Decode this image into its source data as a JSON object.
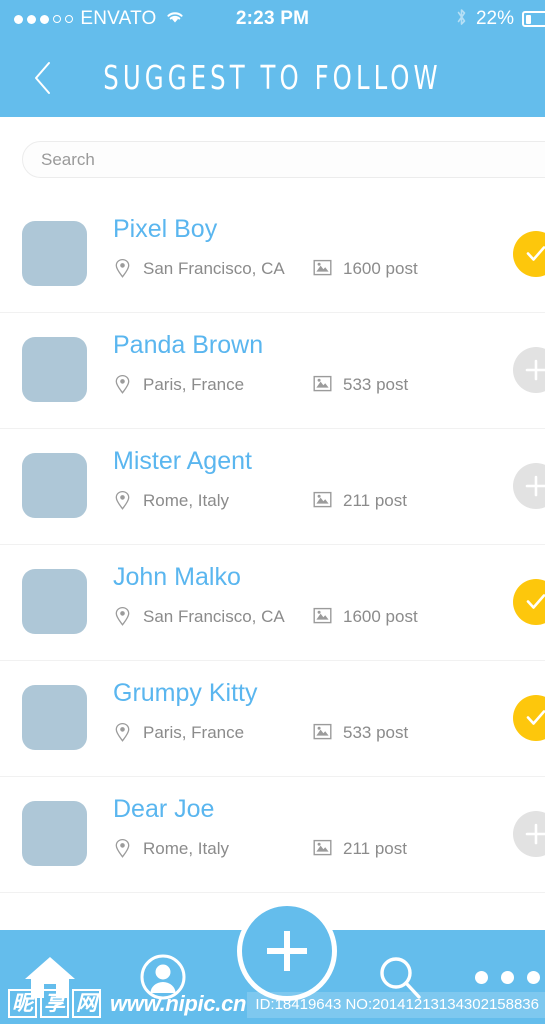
{
  "statusbar": {
    "signal_filled": 3,
    "signal_empty": 2,
    "carrier": "ENVATO",
    "wifi_icon": "wifi-icon",
    "time": "2:23 PM",
    "bluetooth_icon": "bluetooth-icon",
    "battery_percent": "22%",
    "battery_level": 22
  },
  "navbar": {
    "back_icon": "chevron-left-icon",
    "title": "SUGGEST TO FOLLOW"
  },
  "search": {
    "placeholder": "Search",
    "value": ""
  },
  "list": {
    "location_icon": "map-pin-icon",
    "posts_icon": "photo-icon",
    "follow_icon": "plus-icon",
    "following_icon": "check-icon",
    "rows": [
      {
        "name": "Pixel Boy",
        "location": "San Francisco, CA",
        "posts": "1600 post",
        "following": true
      },
      {
        "name": "Panda Brown",
        "location": "Paris, France",
        "posts": "533 post",
        "following": false
      },
      {
        "name": "Mister Agent",
        "location": "Rome, Italy",
        "posts": "211 post",
        "following": false
      },
      {
        "name": "John Malko",
        "location": "San Francisco, CA",
        "posts": "1600 post",
        "following": true
      },
      {
        "name": "Grumpy Kitty",
        "location": "Paris, France",
        "posts": "533 post",
        "following": true
      },
      {
        "name": "Dear Joe",
        "location": "Rome, Italy",
        "posts": "211 post",
        "following": false
      }
    ]
  },
  "tabbar": {
    "items": [
      {
        "icon": "home-icon",
        "key": "home"
      },
      {
        "icon": "person-icon",
        "key": "profile"
      },
      {
        "icon": "plus-icon",
        "key": "create"
      },
      {
        "icon": "search-icon",
        "key": "search"
      },
      {
        "icon": "more-icon",
        "key": "more"
      }
    ]
  },
  "watermark": {
    "logo_chars": [
      "昵",
      "享",
      "网"
    ],
    "url": "www.nipic.cn",
    "id_text": "ID:18419643 NO:20141213134302158836"
  },
  "colors": {
    "brand_blue": "#64bdec",
    "name_blue": "#5ab6ef",
    "accent_yellow": "#fdc70c",
    "avatar_grey": "#aec7d7",
    "inactive_grey": "#e2e2e2",
    "meta_text": "#8b8b8b"
  }
}
